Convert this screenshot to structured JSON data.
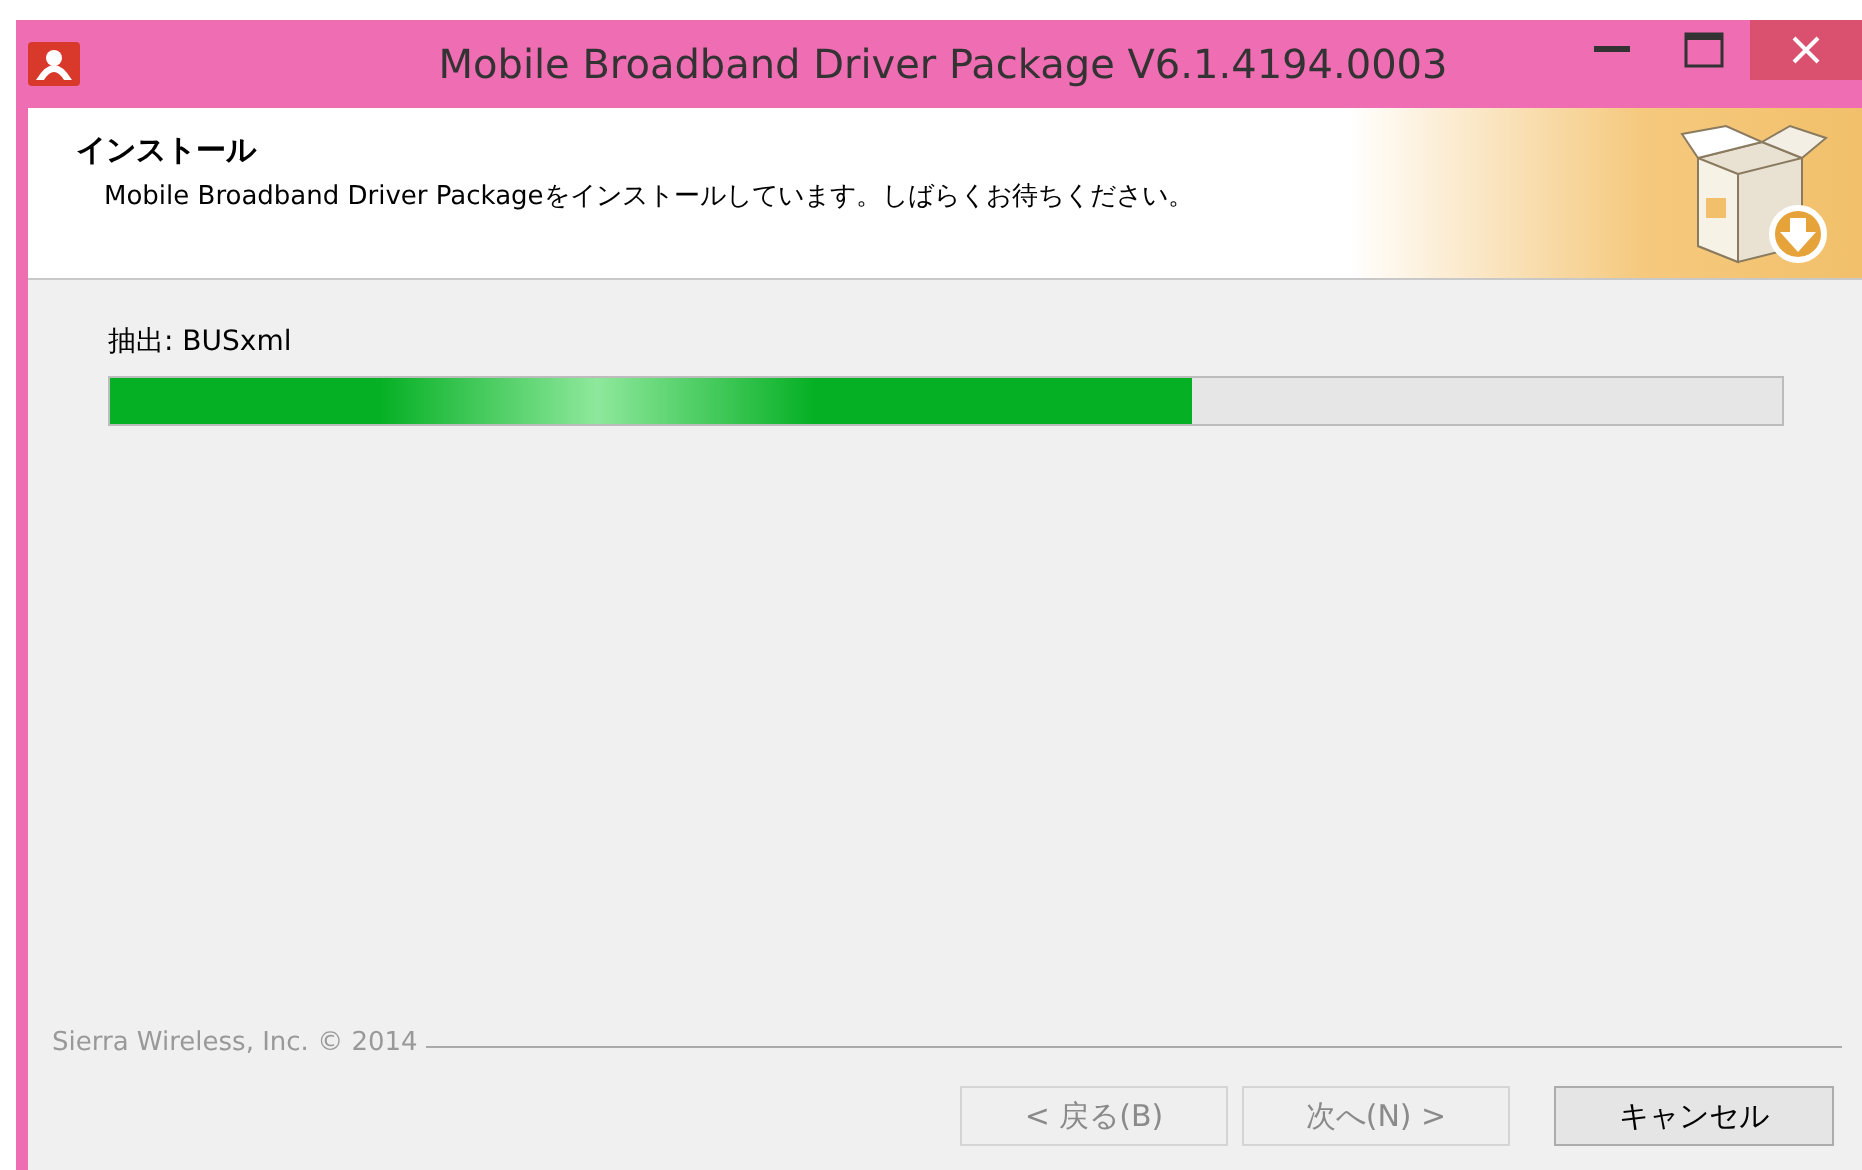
{
  "window": {
    "title": "Mobile Broadband Driver Package V6.1.4194.0003"
  },
  "header": {
    "title": "インストール",
    "description": "Mobile Broadband Driver Packageをインストールしています。しばらくお待ちください。"
  },
  "progress": {
    "status": "抽出: BUSxml",
    "level": 0.647
  },
  "footer": {
    "brand": "Sierra Wireless, Inc. © 2014"
  },
  "buttons": [
    {
      "label": "< 戻る(B)",
      "disabled": true
    },
    {
      "label": "次へ(N) >",
      "disabled": true
    },
    {
      "label": "キャンセル",
      "disabled": false
    }
  ]
}
